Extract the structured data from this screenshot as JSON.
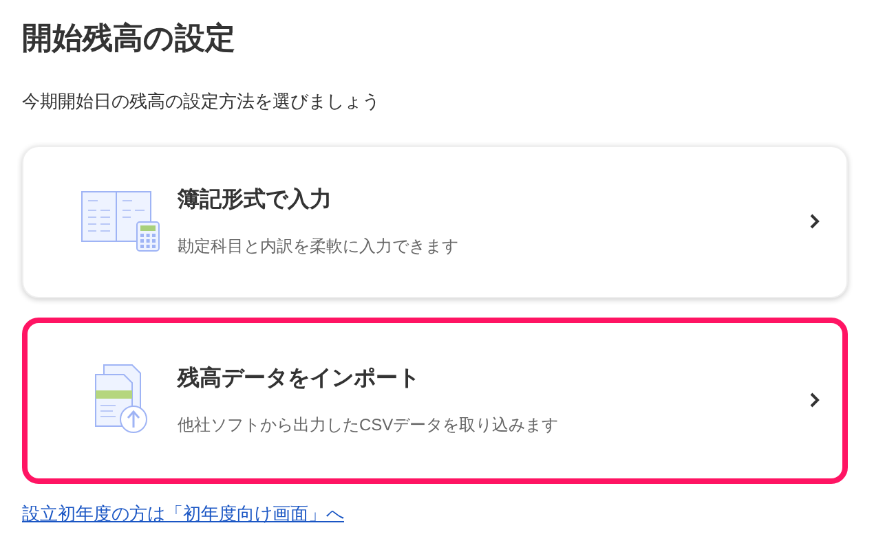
{
  "title": "開始残高の設定",
  "subtitle": "今期開始日の残高の設定方法を選びましょう",
  "options": [
    {
      "kind": "ledger",
      "title": "簿記形式で入力",
      "description": "勘定科目と内訳を柔軟に入力できます",
      "highlighted": false
    },
    {
      "kind": "import",
      "title": "残高データをインポート",
      "description": "他社ソフトから出力したCSVデータを取り込みます",
      "highlighted": true
    }
  ],
  "link": "設立初年度の方は「初年度向け画面」へ"
}
